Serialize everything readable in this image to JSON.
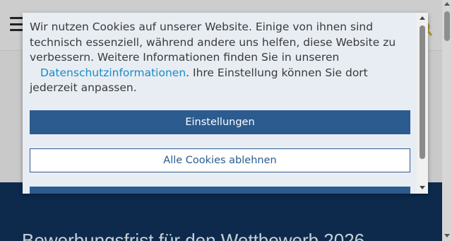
{
  "cookie_banner": {
    "text_before_link": "Wir nutzen Cookies auf unserer Website. Einige von ihnen sind technisch essenziell, während andere uns helfen, diese Website zu verbessern. Weitere Informationen finden Sie in unseren",
    "link_label": "Datenschutzinformationen",
    "text_after_link": ". Ihre Einstellung können Sie dort jederzeit anpassen.",
    "settings_button": "Einstellungen",
    "reject_button": "Alle Cookies ablehnen"
  },
  "page": {
    "hero_title": "Bewerbungsfrist für den Wettbewerb 2026"
  },
  "icons": {
    "menu": "hamburger-menu-icon",
    "header_right": "search-icon"
  },
  "colors": {
    "primary": "#2b5b8f",
    "link": "#1a8bc6",
    "hero_background": "#0d2a4d",
    "modal_background": "#e8edf3"
  }
}
